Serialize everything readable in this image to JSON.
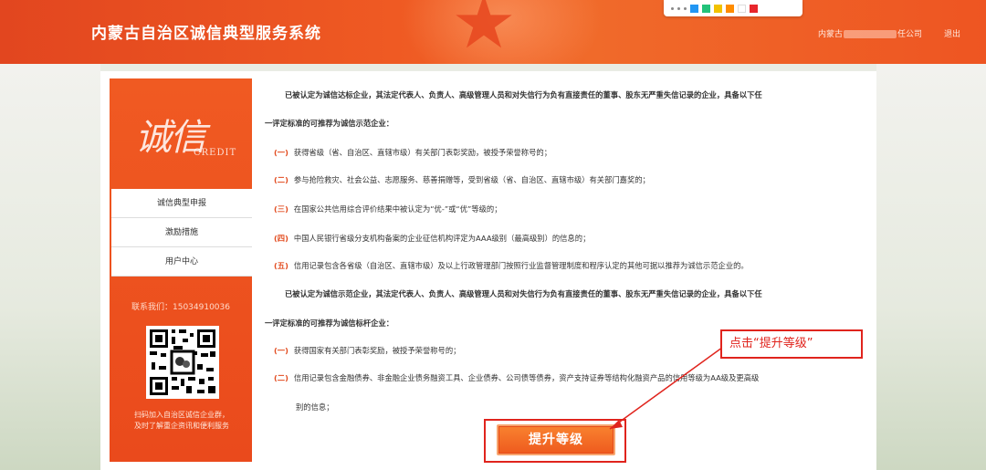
{
  "header": {
    "title": "内蒙古自治区诚信典型服务系统",
    "user_prefix": "内蒙古",
    "user_suffix": "任公司",
    "logout": "退出"
  },
  "palette": {
    "swatches": [
      "#2196f3",
      "#22c27a",
      "#f2c200",
      "#ff8c00",
      "#ffffff",
      "#e8262c"
    ]
  },
  "sidebar": {
    "logo_cn": "诚信",
    "logo_en": "CREDIT",
    "items": [
      {
        "label": "诚信典型申报"
      },
      {
        "label": "激励措施"
      },
      {
        "label": "用户中心"
      }
    ],
    "contact": "联系我们：15034910036",
    "qr_caption_1": "扫码加入自治区诚信企业群，",
    "qr_caption_2": "及时了解重企资讯和便利服务"
  },
  "content": {
    "intro1_a": "已被认定为诚信达标企业，其法定代表人、负责人、高级管理人员和对失信行为负有直接责任的董事、股东无严重失信记录的企业，具备以下任",
    "intro1_b": "一评定标准的可推荐为诚信示范企业：",
    "list1": [
      {
        "num": "(一)",
        "text": "获得省级（省、自治区、直辖市级）有关部门表彰奖励，被授予荣誉称号的；"
      },
      {
        "num": "(二)",
        "text": "参与抢险救灾、社会公益、志愿服务、慈善捐赠等，受到省级（省、自治区、直辖市级）有关部门嘉奖的；"
      },
      {
        "num": "(三)",
        "text": "在国家公共信用综合评价结果中被认定为“优-”或“优”等级的；"
      },
      {
        "num": "(四)",
        "text": "中国人民银行省级分支机构备案的企业征信机构评定为AAA级别（最高级别）的信息的；"
      },
      {
        "num": "(五)",
        "text": "信用记录包含各省级（自治区、直辖市级）及以上行政管理部门按照行业监督管理制度和程序认定的其他可据以推荐为诚信示范企业的。"
      }
    ],
    "intro2_a": "已被认定为诚信示范企业，其法定代表人、负责人、高级管理人员和对失信行为负有直接责任的董事、股东无严重失信记录的企业，具备以下任",
    "intro2_b": "一评定标准的可推荐为诚信标杆企业：",
    "list2": [
      {
        "num": "(一)",
        "text": "获得国家有关部门表彰奖励，被授予荣誉称号的；"
      },
      {
        "num": "(二)",
        "text": "信用记录包含金融债券、非金融企业债务融资工具、企业债券、公司债等债券，资产支持证券等结构化融资产品的信用等级为AA级及更高级"
      }
    ],
    "list2_cont": "别的信息；"
  },
  "upgrade_button": "提升等级",
  "annotation": "点击“提升等级”"
}
